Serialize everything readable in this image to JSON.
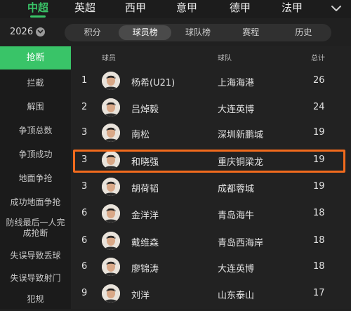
{
  "league_tabs": [
    {
      "label": "中超",
      "active": true
    },
    {
      "label": "英超"
    },
    {
      "label": "西甲"
    },
    {
      "label": "意甲"
    },
    {
      "label": "德甲"
    },
    {
      "label": "法甲"
    }
  ],
  "more_icon": "chevron-down-icon",
  "season": "2026",
  "season_icon": "chevron-down-icon",
  "segment_tabs": [
    {
      "label": "积分"
    },
    {
      "label": "球员榜",
      "active": true
    },
    {
      "label": "球队榜"
    },
    {
      "label": "赛程"
    },
    {
      "label": "历史"
    }
  ],
  "sidebar": {
    "items": [
      {
        "label": "抢断",
        "active": true
      },
      {
        "label": "拦截"
      },
      {
        "label": "解围"
      },
      {
        "label": "争顶总数"
      },
      {
        "label": "争顶成功"
      },
      {
        "label": "地面争抢"
      },
      {
        "label": "成功地面争抢"
      },
      {
        "label": "防线最后一人完成抢断"
      },
      {
        "label": "失误导致丢球"
      },
      {
        "label": "失误导致射门"
      },
      {
        "label": "犯规"
      }
    ]
  },
  "table": {
    "headers": {
      "player": "球员",
      "team": "球队",
      "total": "总计"
    },
    "rows": [
      {
        "rank": "1",
        "name": "杨希(U21)",
        "team": "上海海港",
        "total": "26"
      },
      {
        "rank": "2",
        "name": "吕焯毅",
        "team": "大连英博",
        "total": "24"
      },
      {
        "rank": "3",
        "name": "南松",
        "team": "深圳新鹏城",
        "total": "19"
      },
      {
        "rank": "3",
        "name": "和晓强",
        "team": "重庆铜梁龙",
        "total": "19",
        "highlighted": true
      },
      {
        "rank": "3",
        "name": "胡荷韬",
        "team": "成都蓉城",
        "total": "19"
      },
      {
        "rank": "6",
        "name": "金洋洋",
        "team": "青岛海牛",
        "total": "18"
      },
      {
        "rank": "6",
        "name": "戴维森",
        "team": "青岛西海岸",
        "total": "18"
      },
      {
        "rank": "6",
        "name": "廖锦涛",
        "team": "大连英博",
        "total": "18"
      },
      {
        "rank": "9",
        "name": "刘洋",
        "team": "山东泰山",
        "total": "17"
      }
    ]
  },
  "colors": {
    "accent": "#39c468",
    "highlight": "#f26b1d",
    "background": "#202020"
  }
}
